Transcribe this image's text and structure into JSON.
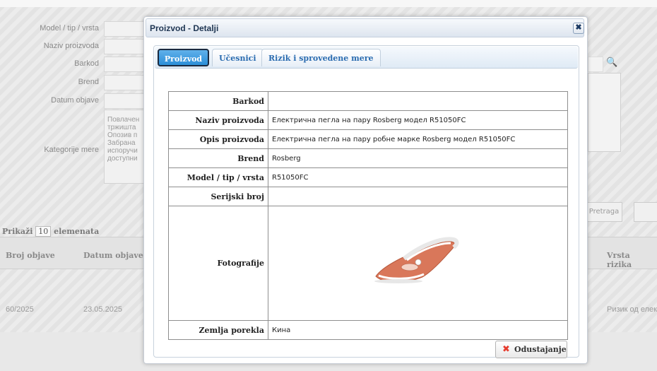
{
  "background": {
    "labels": [
      "Model / tip / vrsta",
      "Naziv proizvoda",
      "Barkod",
      "Brend",
      "Datum objave",
      "Kategorije mere"
    ],
    "textarea_lines": [
      "Повлачен",
      "тржишта",
      "Опозив п",
      "Забрана",
      "испоручи",
      "доступни"
    ],
    "pretraga_label": "Pretraga",
    "prikazi": {
      "prefix": "Prikaži",
      "value": "10",
      "suffix": "elemenata"
    },
    "columns": [
      "Broj objave",
      "Datum objave",
      "Vrsta rizika"
    ],
    "row": {
      "broj": "60/2025",
      "datum": "23.05.2025",
      "rizik": "Ризик од елек"
    }
  },
  "dialog": {
    "title": "Proizvod - Detalji",
    "tabs": [
      {
        "label": "Proizvod",
        "active": true
      },
      {
        "label": "Učesnici",
        "active": false
      },
      {
        "label": "Rizik i sprovedene mere",
        "active": false
      }
    ],
    "rows": [
      {
        "key": "Barkod",
        "value": ""
      },
      {
        "key": "Naziv proizvoda",
        "value": "Електрична пегла на пару Rosberg модел R51050FC"
      },
      {
        "key": "Opis proizvoda",
        "value": "Електрична пегла на пару робне марке Rosberg модел R51050FC"
      },
      {
        "key": "Brend",
        "value": "Rosberg"
      },
      {
        "key": "Model / tip / vrsta",
        "value": "R51050FC"
      },
      {
        "key": "Serijski broj",
        "value": ""
      },
      {
        "key": "Fotografije",
        "value": ""
      },
      {
        "key": "Zemlja porekla",
        "value": "Кина"
      }
    ],
    "cancel_label": "Odustajanje"
  },
  "icons": {
    "close": "close-icon",
    "cancel": "cancel-x-icon",
    "search": "search-icon"
  },
  "colors": {
    "tab_active": "#2c8fd8",
    "cancel_x": "#e63c2e",
    "iron": "#d9775a"
  }
}
